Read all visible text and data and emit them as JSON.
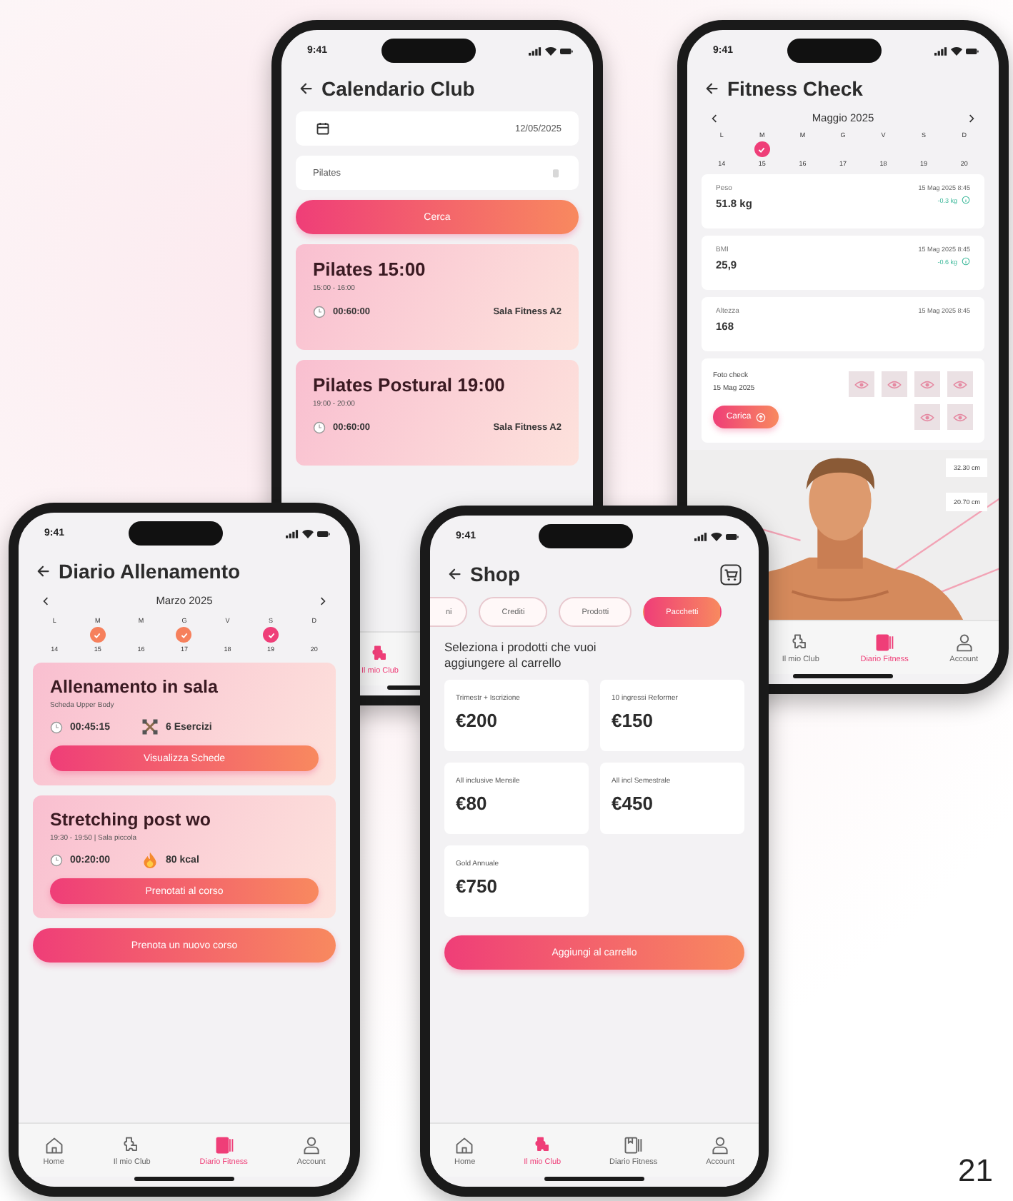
{
  "phones": [
    {
      "kind": "calendar_search",
      "time": "9:41",
      "title": "Calendario Club",
      "date_field": {
        "value": "12/05/2025"
      },
      "search_field": {
        "value": "Pilates"
      },
      "search_button": "Cerca",
      "classes": [
        {
          "title": "Pilates 15:00",
          "hours": "15:00 - 16:00",
          "duration": "00:60:00",
          "room": "Sala Fitness A2"
        },
        {
          "title": "Pilates Postural 19:00",
          "hours": "19:00 - 20:00",
          "duration": "00:60:00",
          "room": "Sala Fitness A2"
        }
      ],
      "nav": [
        {
          "label": "Il mio Club",
          "kind": "club",
          "selected": true
        }
      ]
    },
    {
      "kind": "fitness_check",
      "time": "9:41",
      "title": "Fitness Check",
      "month": "Maggio 2025",
      "days": [
        {
          "weekday": "L",
          "day": "14",
          "checked": false
        },
        {
          "weekday": "M",
          "day": "15",
          "checked": true,
          "color": "#ef3e78"
        },
        {
          "weekday": "M",
          "day": "16",
          "checked": false
        },
        {
          "weekday": "G",
          "day": "17",
          "checked": false
        },
        {
          "weekday": "V",
          "day": "18",
          "checked": false
        },
        {
          "weekday": "S",
          "day": "19",
          "checked": false
        },
        {
          "weekday": "D",
          "day": "20",
          "checked": false
        }
      ],
      "measures": [
        {
          "label": "Peso",
          "value": "51.8 kg",
          "date": "15 Mag 2025 8:45",
          "delta": "-0.3 kg"
        },
        {
          "label": "BMI",
          "value": "25,9",
          "date": "15 Mag 2025 8:45",
          "delta": "-0.6 kg"
        },
        {
          "label": "Altezza",
          "value": "168",
          "date": "15 Mag 2025 8:45"
        }
      ],
      "photo_check": {
        "label": "Foto check",
        "date": "15 Mag 2025",
        "button": "Carica"
      },
      "body_measures": [
        "32.30 cm",
        "20.70 cm"
      ],
      "nav": [
        {
          "label": "Il mio Club",
          "kind": "club",
          "selected": false
        },
        {
          "label": "Diario Fitness",
          "kind": "diary",
          "selected": true
        },
        {
          "label": "Account",
          "kind": "account",
          "selected": false
        }
      ]
    },
    {
      "kind": "training_diary",
      "time": "9:41",
      "title": "Diario Allenamento",
      "month": "Marzo 2025",
      "days": [
        {
          "weekday": "L",
          "day": "14",
          "checked": false
        },
        {
          "weekday": "M",
          "day": "15",
          "checked": true,
          "color": "#f6805c"
        },
        {
          "weekday": "M",
          "day": "16",
          "checked": false
        },
        {
          "weekday": "G",
          "day": "17",
          "checked": true,
          "color": "#f6805c"
        },
        {
          "weekday": "V",
          "day": "18",
          "checked": false
        },
        {
          "weekday": "S",
          "day": "19",
          "checked": true,
          "color": "#ef3e78"
        },
        {
          "weekday": "D",
          "day": "20",
          "checked": false
        }
      ],
      "workouts": [
        {
          "title": "Allenamento in sala",
          "subtitle": "Scheda Upper Body",
          "duration": "00:45:15",
          "stat": "6 Esercizi",
          "kind": "exercises",
          "button": "Visualizza Schede"
        },
        {
          "title": "Stretching post wo",
          "subtitle": "19:30 - 19:50 | Sala piccola",
          "duration": "00:20:00",
          "stat": "80 kcal",
          "kind": "calories",
          "button": "Prenotati al corso"
        }
      ],
      "main_button": "Prenota un nuovo corso",
      "nav": [
        {
          "label": "Home",
          "kind": "home",
          "selected": false
        },
        {
          "label": "Il mio Club",
          "kind": "club",
          "selected": false
        },
        {
          "label": "Diario Fitness",
          "kind": "diary",
          "selected": true
        },
        {
          "label": "Account",
          "kind": "account",
          "selected": false
        }
      ]
    },
    {
      "kind": "shop",
      "time": "9:41",
      "title": "Shop",
      "chips": [
        {
          "label": "ni",
          "selected": false
        },
        {
          "label": "Crediti",
          "selected": false
        },
        {
          "label": "Prodotti",
          "selected": false
        },
        {
          "label": "Pacchetti",
          "selected": true
        }
      ],
      "intro": "Seleziona i prodotti che vuoi aggiungere al carrello",
      "products": [
        {
          "name": "Trimestr + Iscrizione",
          "price": "€200"
        },
        {
          "name": "10 ingressi Reformer",
          "price": "€150"
        },
        {
          "name": "All inclusive Mensile",
          "price": "€80"
        },
        {
          "name": "All incl Semestrale",
          "price": "€450"
        },
        {
          "name": "Gold Annuale",
          "price": "€750"
        }
      ],
      "button": "Aggiungi al carrello",
      "nav": [
        {
          "label": "Home",
          "kind": "home",
          "selected": false
        },
        {
          "label": "Il mio Club",
          "kind": "club",
          "selected": true
        },
        {
          "label": "Diario Fitness",
          "kind": "diary",
          "selected": false
        },
        {
          "label": "Account",
          "kind": "account",
          "selected": false
        }
      ]
    }
  ],
  "page_number": "21"
}
